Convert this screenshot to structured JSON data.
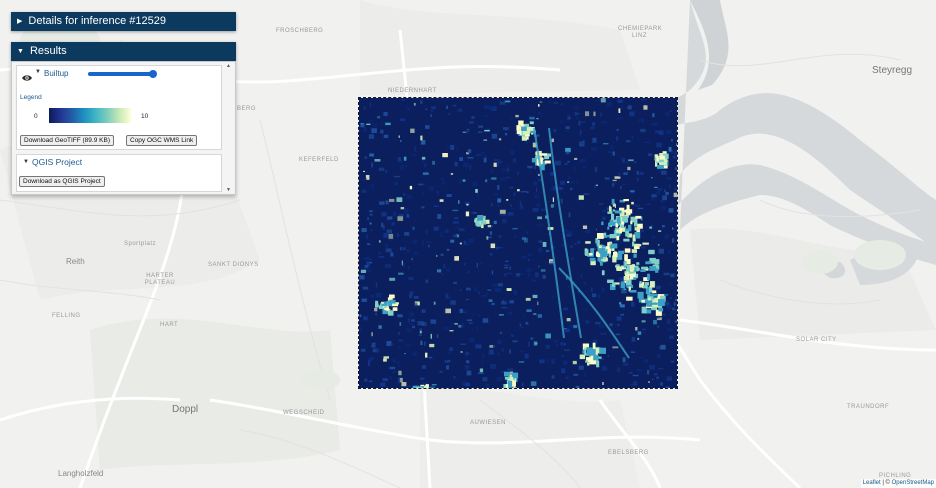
{
  "details_panel": {
    "title": "Details for inference #12529"
  },
  "results_panel": {
    "title": "Results",
    "layer": {
      "name": "Builtup",
      "visibility_icon": "eye-icon",
      "opacity": 1.0,
      "legend_label": "Legend",
      "legend_min": "0",
      "legend_max": "10",
      "legend_colors": [
        "#081d58",
        "#253494",
        "#225ea8",
        "#1d91c0",
        "#41b6c4",
        "#7fcdbb",
        "#c7e9b4",
        "#ffffd9"
      ],
      "download_button": "Download GeoTIFF (89.9 KB)",
      "copy_button": "Copy OGC WMS Link"
    },
    "qgis": {
      "title": "QGIS Project",
      "download_button": "Download as QGIS Project"
    }
  },
  "map_labels": [
    "FROSCHBERG",
    "CHEMIEPARK",
    "LINZ",
    "Steyregg",
    "NIEDERNHART",
    "KEFERFELD",
    "Reith",
    "HARTER PLATEAU",
    "SANKT DIONYS",
    "FELLING",
    "HART",
    "Doppl",
    "WEGSCHEID",
    "AUWIESEN",
    "EBELSBERG",
    "SOLAR CITY",
    "TRAUNDORF",
    "Langholzfeld",
    "PICHLING",
    "Sportplatz",
    "BERG"
  ],
  "attribution": {
    "leaflet": "Leaflet",
    "sep": " | © ",
    "osm": "OpenStreetMap"
  }
}
